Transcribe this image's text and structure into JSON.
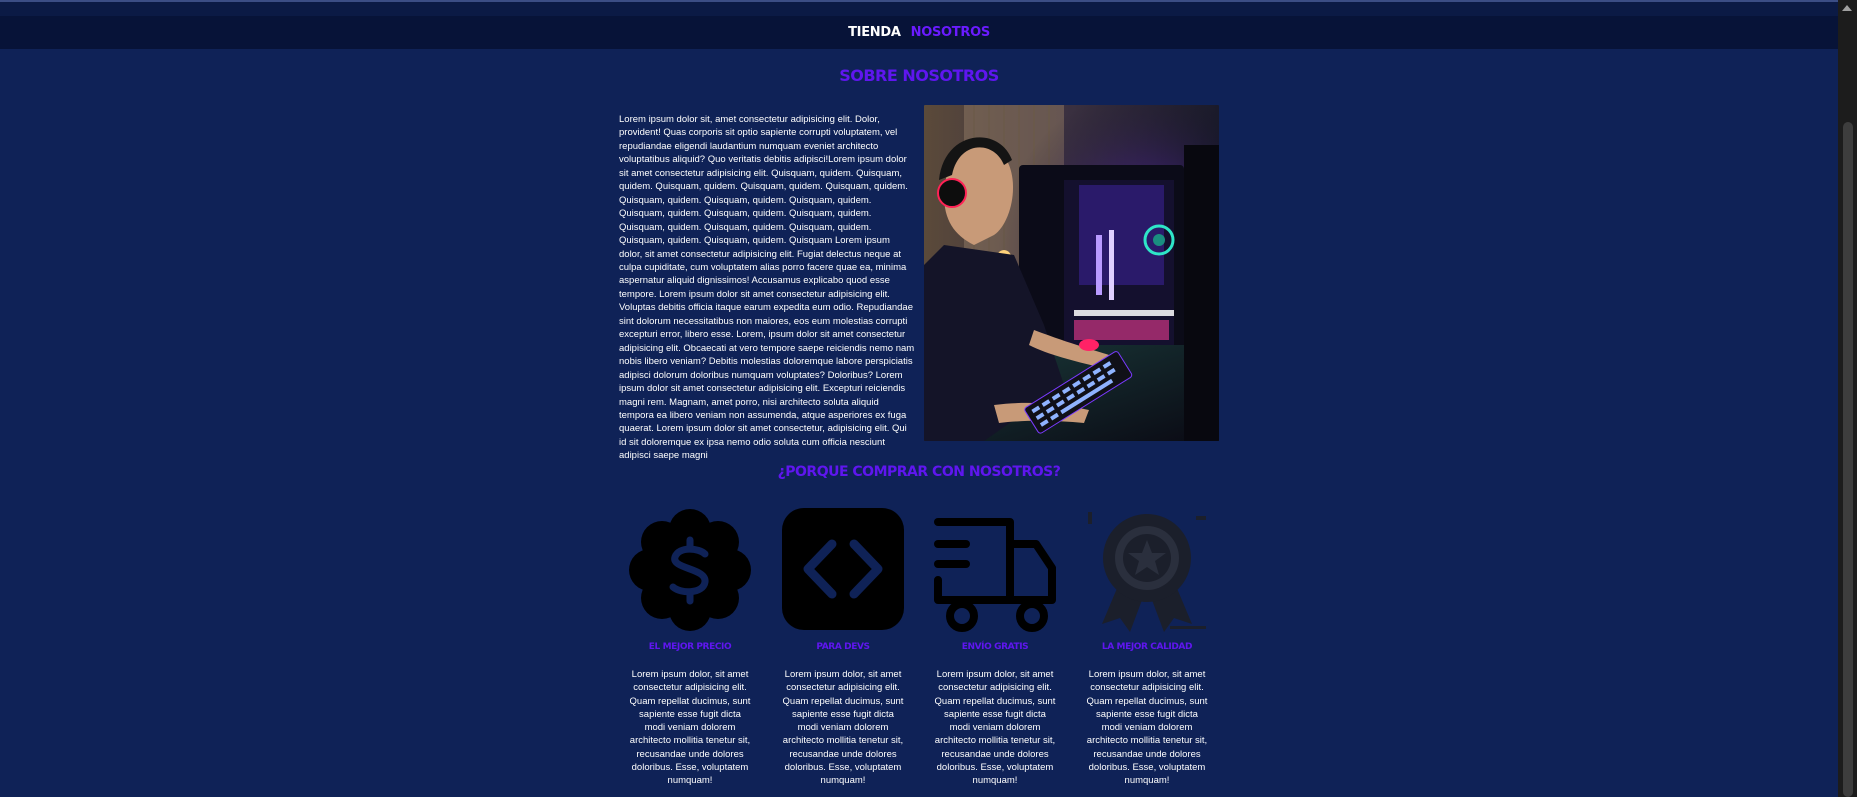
{
  "nav": {
    "items": [
      {
        "label": "TIENDA"
      },
      {
        "label": "NOSOTROS"
      }
    ]
  },
  "about": {
    "title": "SOBRE NOSOTROS",
    "paragraph": "Lorem ipsum dolor sit, amet consectetur adipisicing elit. Dolor, provident! Quas corporis sit optio sapiente corrupti voluptatem, vel repudiandae eligendi laudantium numquam eveniet architecto voluptatibus aliquid? Quo veritatis debitis adipisci!Lorem ipsum dolor sit amet consectetur adipisicing elit. Quisquam, quidem. Quisquam, quidem. Quisquam, quidem. Quisquam, quidem. Quisquam, quidem. Quisquam, quidem. Quisquam, quidem. Quisquam, quidem. Quisquam, quidem. Quisquam, quidem. Quisquam, quidem. Quisquam, quidem. Quisquam, quidem. Quisquam, quidem. Quisquam, quidem. Quisquam, quidem. Quisquam Lorem ipsum dolor, sit amet consectetur adipisicing elit. Fugiat delectus neque at culpa cupiditate, cum voluptatem alias porro facere quae ea, minima aspernatur aliquid dignissimos! Accusamus explicabo quod esse tempore. Lorem ipsum dolor sit amet consectetur adipisicing elit. Voluptas debitis officia itaque earum expedita eum odio. Repudiandae sint dolorum necessitatibus non maiores, eos eum molestias corrupti excepturi error, libero esse. Lorem, ipsum dolor sit amet consectetur adipisicing elit. Obcaecati at vero tempore saepe reiciendis nemo nam nobis libero veniam? Debitis molestias doloremque labore perspiciatis adipisci dolorum doloribus numquam voluptates? Doloribus? Lorem ipsum dolor sit amet consectetur adipisicing elit. Excepturi reiciendis magni rem. Magnam, amet porro, nisi architecto soluta aliquid tempora ea libero veniam non assumenda, atque asperiores ex fuga quaerat. Lorem ipsum dolor sit amet consectetur, adipisicing elit. Qui id sit doloremque ex ipsa nemo odio soluta cum officia nesciunt adipisci saepe magni"
  },
  "why": {
    "title": "¿PORQUE COMPRAR CON NOSOTROS?",
    "features": [
      {
        "icon": "dollar-badge-icon",
        "title": "EL MEJOR PRECIO",
        "desc": "Lorem ipsum dolor, sit amet consectetur adipisicing elit. Quam repellat ducimus, sunt sapiente esse fugit dicta modi veniam dolorem architecto mollitia tenetur sit, recusandae unde dolores doloribus. Esse, voluptatem numquam!"
      },
      {
        "icon": "code-icon",
        "title": "PARA DEVS",
        "desc": "Lorem ipsum dolor, sit amet consectetur adipisicing elit. Quam repellat ducimus, sunt sapiente esse fugit dicta modi veniam dolorem architecto mollitia tenetur sit, recusandae unde dolores doloribus. Esse, voluptatem numquam!"
      },
      {
        "icon": "delivery-truck-icon",
        "title": "ENVÍO GRATIS",
        "desc": "Lorem ipsum dolor, sit amet consectetur adipisicing elit. Quam repellat ducimus, sunt sapiente esse fugit dicta modi veniam dolorem architecto mollitia tenetur sit, recusandae unde dolores doloribus. Esse, voluptatem numquam!"
      },
      {
        "icon": "quality-medal-icon",
        "title": "LA MEJOR CALIDAD",
        "desc": "Lorem ipsum dolor, sit amet consectetur adipisicing elit. Quam repellat ducimus, sunt sapiente esse fugit dicta modi veniam dolorem architecto mollitia tenetur sit, recusandae unde dolores doloribus. Esse, voluptatem numquam!"
      }
    ]
  },
  "colors": {
    "background": "#0f2257",
    "navbar": "#071338",
    "accent": "#5f16ef",
    "text": "#ffffff"
  }
}
